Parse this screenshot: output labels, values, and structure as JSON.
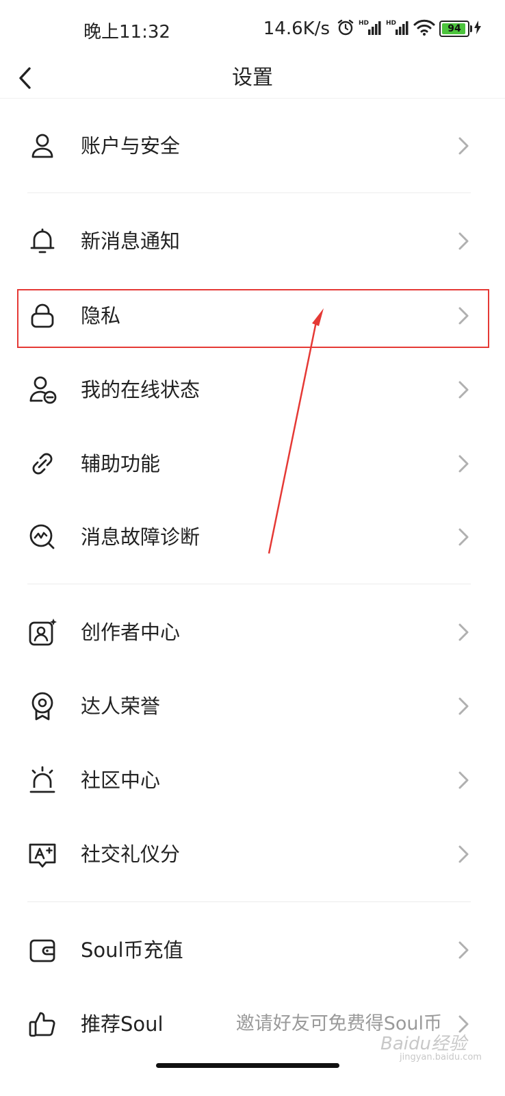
{
  "status_bar": {
    "time": "晚上11:32",
    "net_speed": "14.6K/s",
    "battery_level": "94",
    "battery_color": "#4cc43d"
  },
  "nav": {
    "title": "设置",
    "back_icon": "chevron-left-icon"
  },
  "settings": {
    "items": [
      {
        "label": "账户与安全",
        "icon": "user-icon"
      },
      {
        "label": "新消息通知",
        "icon": "bell-icon"
      },
      {
        "label": "隐私",
        "icon": "lock-icon"
      },
      {
        "label": "我的在线状态",
        "icon": "user-status-icon"
      },
      {
        "label": "辅助功能",
        "icon": "link-icon"
      },
      {
        "label": "消息故障诊断",
        "icon": "diagnose-icon"
      },
      {
        "label": "创作者中心",
        "icon": "creator-icon"
      },
      {
        "label": "达人荣誉",
        "icon": "medal-icon"
      },
      {
        "label": "社区中心",
        "icon": "alarm-light-icon"
      },
      {
        "label": "社交礼仪分",
        "icon": "etiquette-icon"
      },
      {
        "label": "Soul币充值",
        "icon": "wallet-icon"
      },
      {
        "label": "推荐Soul",
        "icon": "thumbs-up-icon",
        "sublabel": "邀请好友可免费得Soul币"
      }
    ]
  },
  "annotation": {
    "highlight_color": "#e53935"
  },
  "watermark": {
    "brand": "Baidu经验",
    "url": "jingyan.baidu.com"
  }
}
